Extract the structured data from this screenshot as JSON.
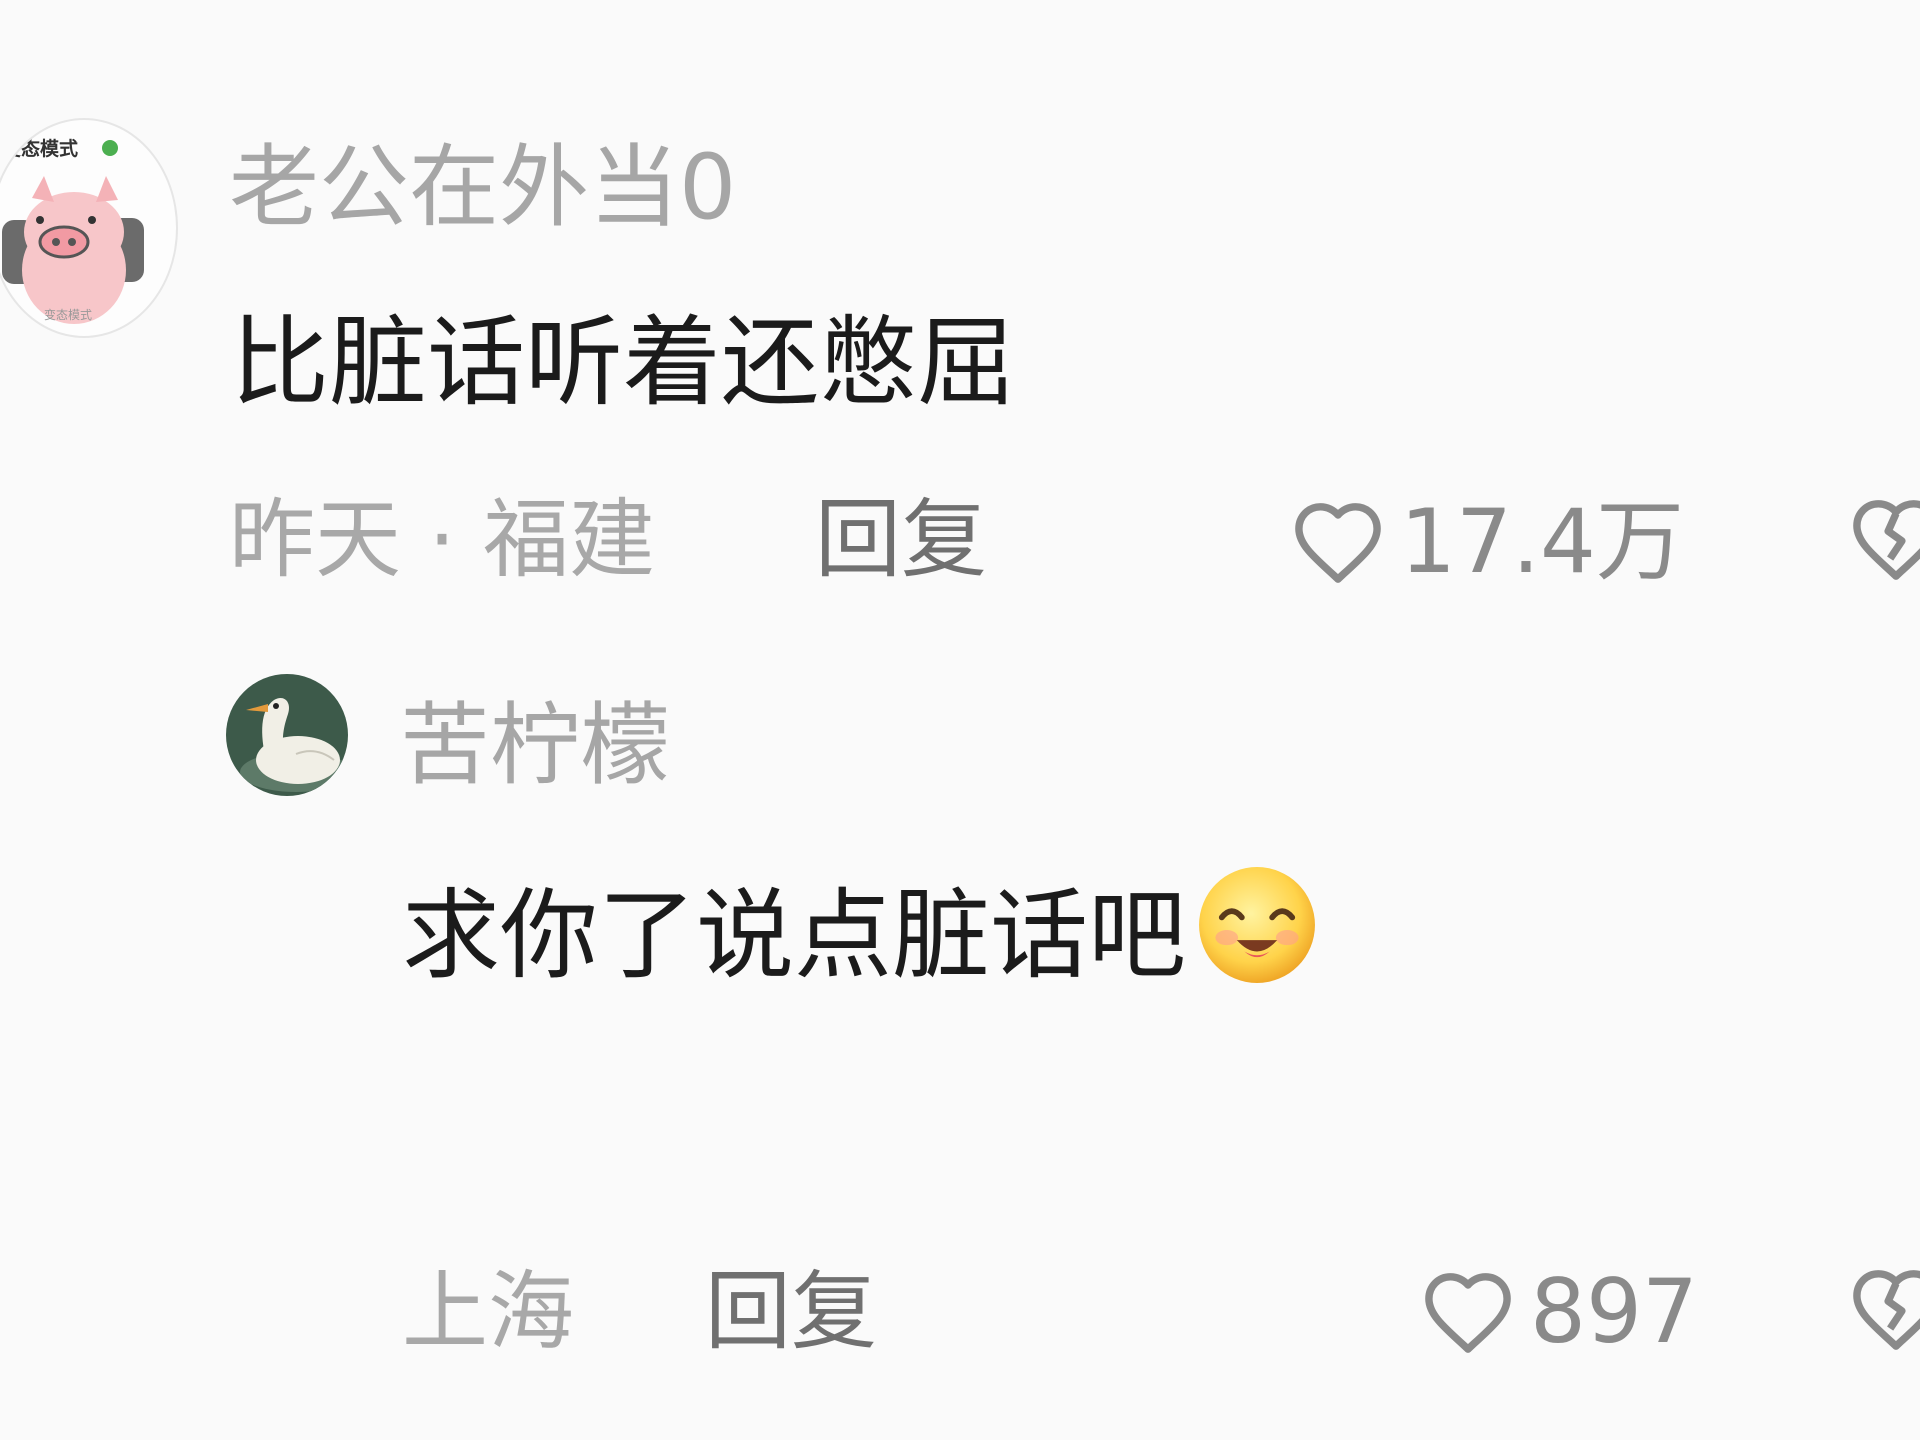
{
  "comment": {
    "avatar": {
      "top_label": "变态模式",
      "bottom_label": "变态模式"
    },
    "username": "老公在外当0",
    "text": "比脏话听着还憋屈",
    "meta": "昨天 · 福建",
    "reply_label": "回复",
    "like_count": "17.4万"
  },
  "reply": {
    "username": "苦柠檬",
    "text": "求你了说点脏话吧",
    "meta": "上海",
    "reply_label": "回复",
    "like_count": "897"
  },
  "icons": {
    "like": "heart-outline-icon",
    "dislike": "broken-heart-icon",
    "emoji": "smiling-face-emoji"
  },
  "colors": {
    "background": "#fafafa",
    "primary_text": "#1b1b1b",
    "secondary_text": "#a8a8a8",
    "reply_text": "#707070",
    "icon": "#8a8a8a"
  }
}
